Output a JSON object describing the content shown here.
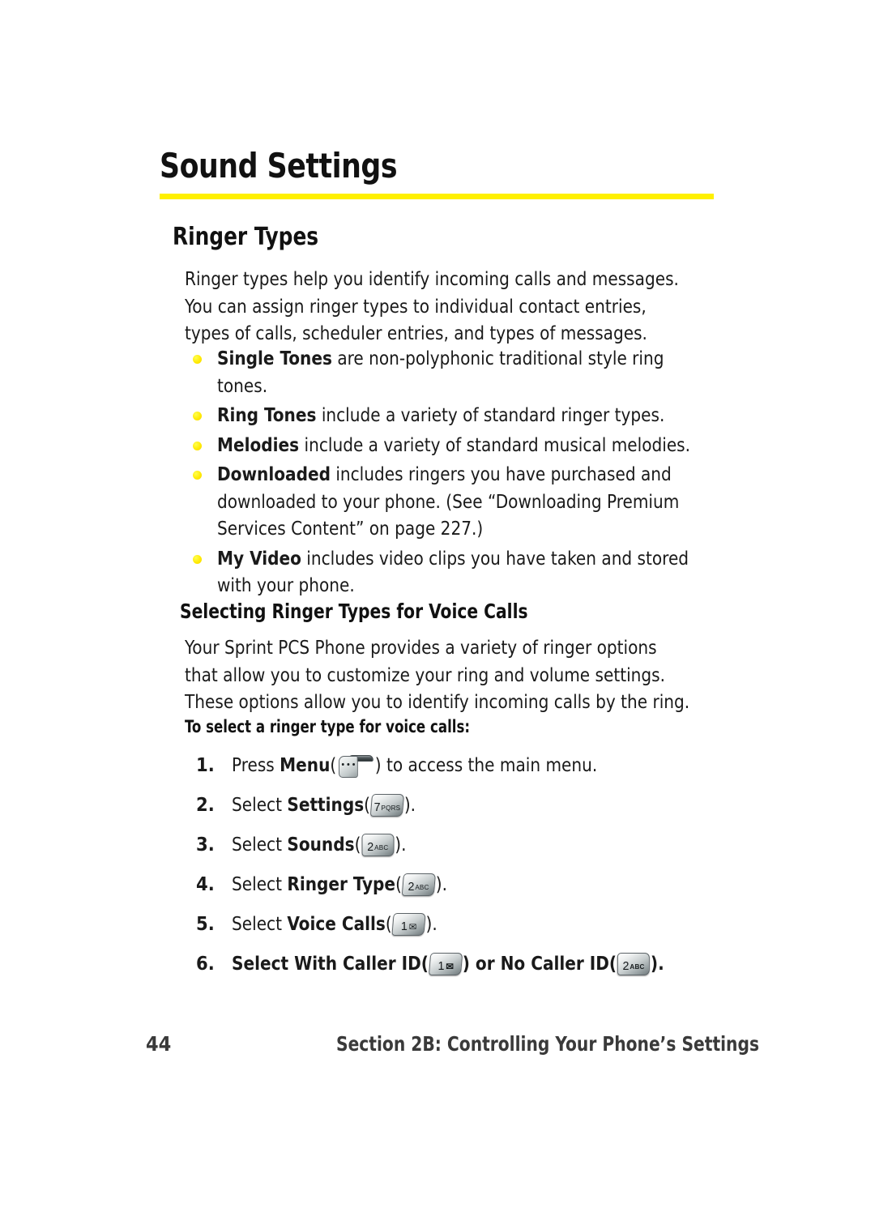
{
  "document": {
    "chapter_title": "Sound Settings",
    "rule_color": "#FFF000",
    "bullet_color": "#FFE800"
  },
  "section": {
    "heading": "Ringer Types",
    "intro_line1": "Ringer types help you identify incoming calls and messages.",
    "intro_line2": "You can assign ringer types to individual contact entries,",
    "intro_line3": "types of calls, scheduler entries, and types of messages."
  },
  "bullets": [
    {
      "term": "Single Tones",
      "rest": " are non-polyphonic traditional style ring tones."
    },
    {
      "term": "Ring Tones",
      "rest": " include a variety of standard ringer types."
    },
    {
      "term": "Melodies",
      "rest": " include a variety of standard musical melodies."
    },
    {
      "term": "Downloaded",
      "rest": " includes ringers you have purchased and downloaded to your phone. (See “Downloading Premium Services Content” on page 227.)"
    },
    {
      "term": "My Video",
      "rest": " includes video clips you have taken and stored with your phone."
    }
  ],
  "subsection": {
    "heading": "Selecting Ringer Types for Voice Calls",
    "para_line1": "Your Sprint PCS Phone provides a variety of ringer options",
    "para_line2": "that allow you to customize your ring and volume settings.",
    "para_line3": "These options allow you to identify incoming calls by the ring.",
    "procedure_lead": "To select a ringer type for voice calls:"
  },
  "steps": [
    {
      "num": "1.",
      "pre": "Press ",
      "bold": "Menu",
      "open_paren": "(",
      "key": {
        "type": "softkey",
        "name": "menu-soft-key"
      },
      "close_paren": ")",
      "post": " to access the main menu."
    },
    {
      "num": "2.",
      "pre": "Select ",
      "bold": "Settings",
      "open_paren": "(",
      "key": {
        "type": "keycap",
        "digit": "7",
        "letters": "PQRS",
        "name": "key-7-pqrs"
      },
      "close_paren": ")",
      "post": "."
    },
    {
      "num": "3.",
      "pre": "Select ",
      "bold": "Sounds",
      "open_paren": "(",
      "key": {
        "type": "keycap",
        "digit": "2",
        "letters": "ABC",
        "name": "key-2-abc"
      },
      "close_paren": ")",
      "post": "."
    },
    {
      "num": "4.",
      "pre": "Select ",
      "bold": "Ringer Type",
      "open_paren": "(",
      "key": {
        "type": "keycap",
        "digit": "2",
        "letters": "ABC",
        "name": "key-2-abc"
      },
      "close_paren": ")",
      "post": "."
    },
    {
      "num": "5.",
      "pre": "Select ",
      "bold": "Voice Calls",
      "open_paren": "(",
      "key": {
        "type": "keycap",
        "digit": "1",
        "envelope": "✉",
        "name": "key-1-voicemail"
      },
      "close_paren": ")",
      "post": "."
    },
    {
      "num": "6.",
      "pre": "Select ",
      "bold": "With Caller ID",
      "open_paren": "(",
      "key": {
        "type": "keycap",
        "digit": "1",
        "envelope": "✉",
        "name": "key-1-voicemail"
      },
      "close_paren": ")",
      "mid": " or ",
      "bold2": "No Caller ID",
      "open_paren2": "(",
      "key2": {
        "type": "keycap",
        "digit": "2",
        "letters": "ABC",
        "name": "key-2-abc"
      },
      "close_paren2": ")",
      "post": ".",
      "all_bold": true
    }
  ],
  "footer": {
    "page_number": "44",
    "section_label": "Section 2B: Controlling Your Phone’s Settings"
  }
}
